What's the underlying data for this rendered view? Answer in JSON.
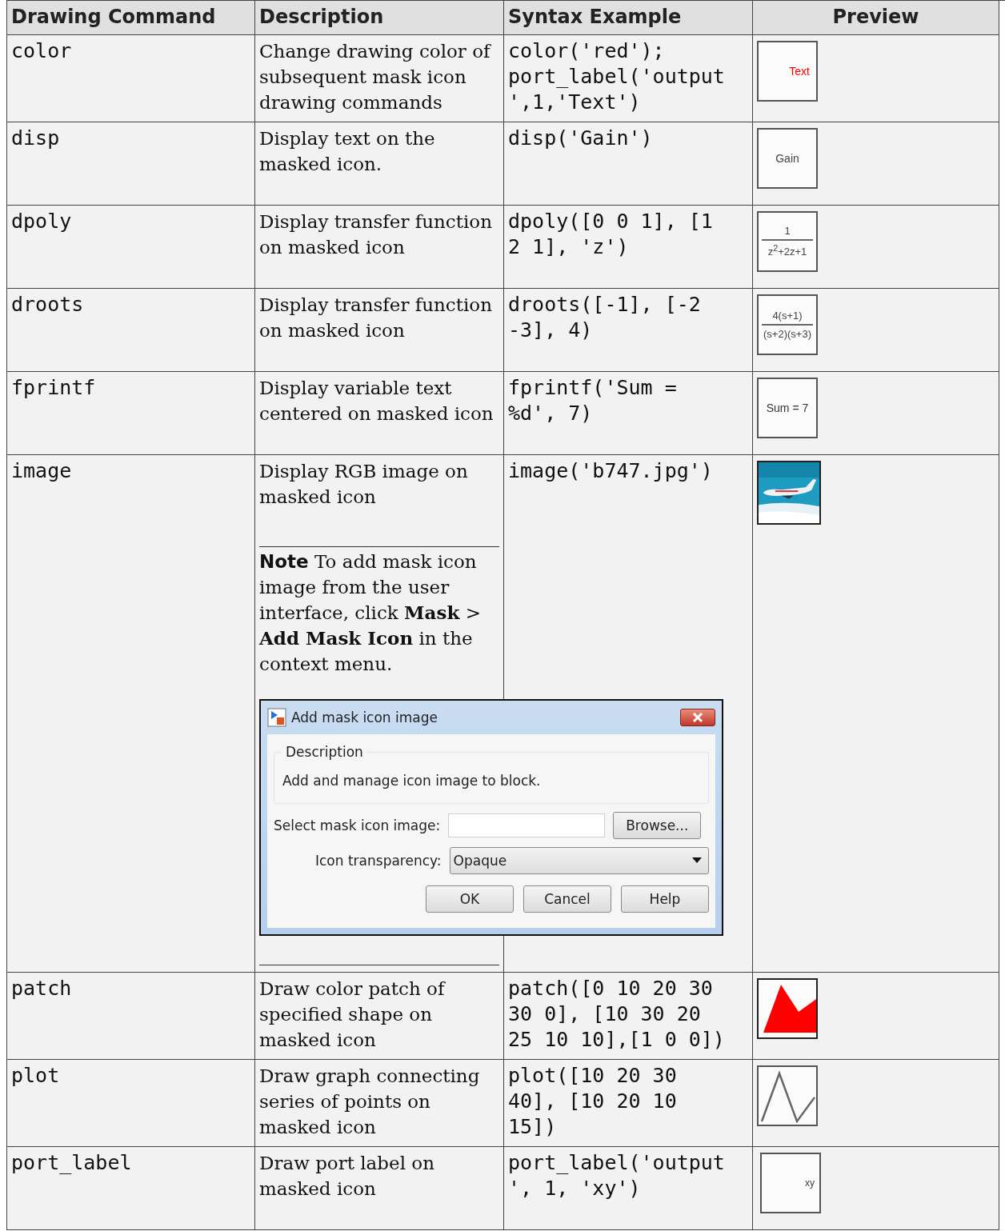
{
  "columns": [
    "Drawing Command",
    "Description",
    "Syntax Example",
    "Preview"
  ],
  "rows": [
    {
      "command": "color",
      "description": "Change drawing color of subsequent mask icon drawing commands",
      "syntax": [
        "color('red');",
        "port_label('output",
        "',1,'Text')"
      ],
      "preview": {
        "kind": "corner_label",
        "text": "Text",
        "color": "#ff0000"
      }
    },
    {
      "command": "disp",
      "description": "Display text on the masked icon.",
      "syntax": [
        "disp('Gain')"
      ],
      "preview": {
        "kind": "label",
        "text": "Gain",
        "color": "#444444"
      }
    },
    {
      "command": "dpoly",
      "description": "Display transfer function on masked icon",
      "syntax": [
        "dpoly([0 0 1], [1",
        "2 1], 'z')"
      ],
      "preview": {
        "kind": "fraction",
        "numerator": "1",
        "denominator": "z$^{2}$+2z+1"
      }
    },
    {
      "command": "droots",
      "description": "Display transfer function on masked icon",
      "syntax": [
        "droots([-1], [-2",
        "-3], 4)"
      ],
      "preview": {
        "kind": "fraction",
        "numerator": "4(s+1)",
        "denominator": "(s+2)(s+3)"
      }
    },
    {
      "command": "fprintf",
      "description": "Display variable text centered on masked icon",
      "syntax": [
        "fprintf('Sum =",
        "%d', 7)"
      ],
      "preview": {
        "kind": "label",
        "text": "Sum = 7",
        "color": "#333333"
      }
    },
    {
      "command": "image",
      "description": "Display RGB image on masked icon",
      "syntax": [
        "image('b747.jpg')"
      ],
      "preview": {
        "kind": "picture"
      },
      "note": "**Note**  To add mask icon image from the user interface, click **Mask** > **Add Mask Icon** in the context menu.",
      "dialog": {
        "title": "Add mask icon image",
        "group": "Description",
        "group_text": "Add and manage icon image to block.",
        "field_label": "Select mask icon image:",
        "browse": "Browse...",
        "select_label": "Icon transparency:",
        "select_value": "Opaque",
        "buttons": [
          "OK",
          "Cancel",
          "Help"
        ]
      }
    },
    {
      "command": "patch",
      "description": "Draw color patch of specified shape on masked icon",
      "syntax": [
        "patch([0 10 20 30",
        "30 0], [10 30 20",
        "25 10 10],[1 0 0])"
      ],
      "preview": {
        "kind": "patch"
      }
    },
    {
      "command": "plot",
      "description": "Draw graph connecting series of points on masked icon",
      "syntax": [
        "plot([10 20 30",
        "40], [10 20 10",
        "15])"
      ],
      "preview": {
        "kind": "plot"
      }
    },
    {
      "command": "port_label",
      "description": "Draw port label on masked icon",
      "syntax": [
        "port_label('output",
        "', 1, 'xy')"
      ],
      "preview": {
        "kind": "port",
        "text": "xy"
      }
    }
  ]
}
